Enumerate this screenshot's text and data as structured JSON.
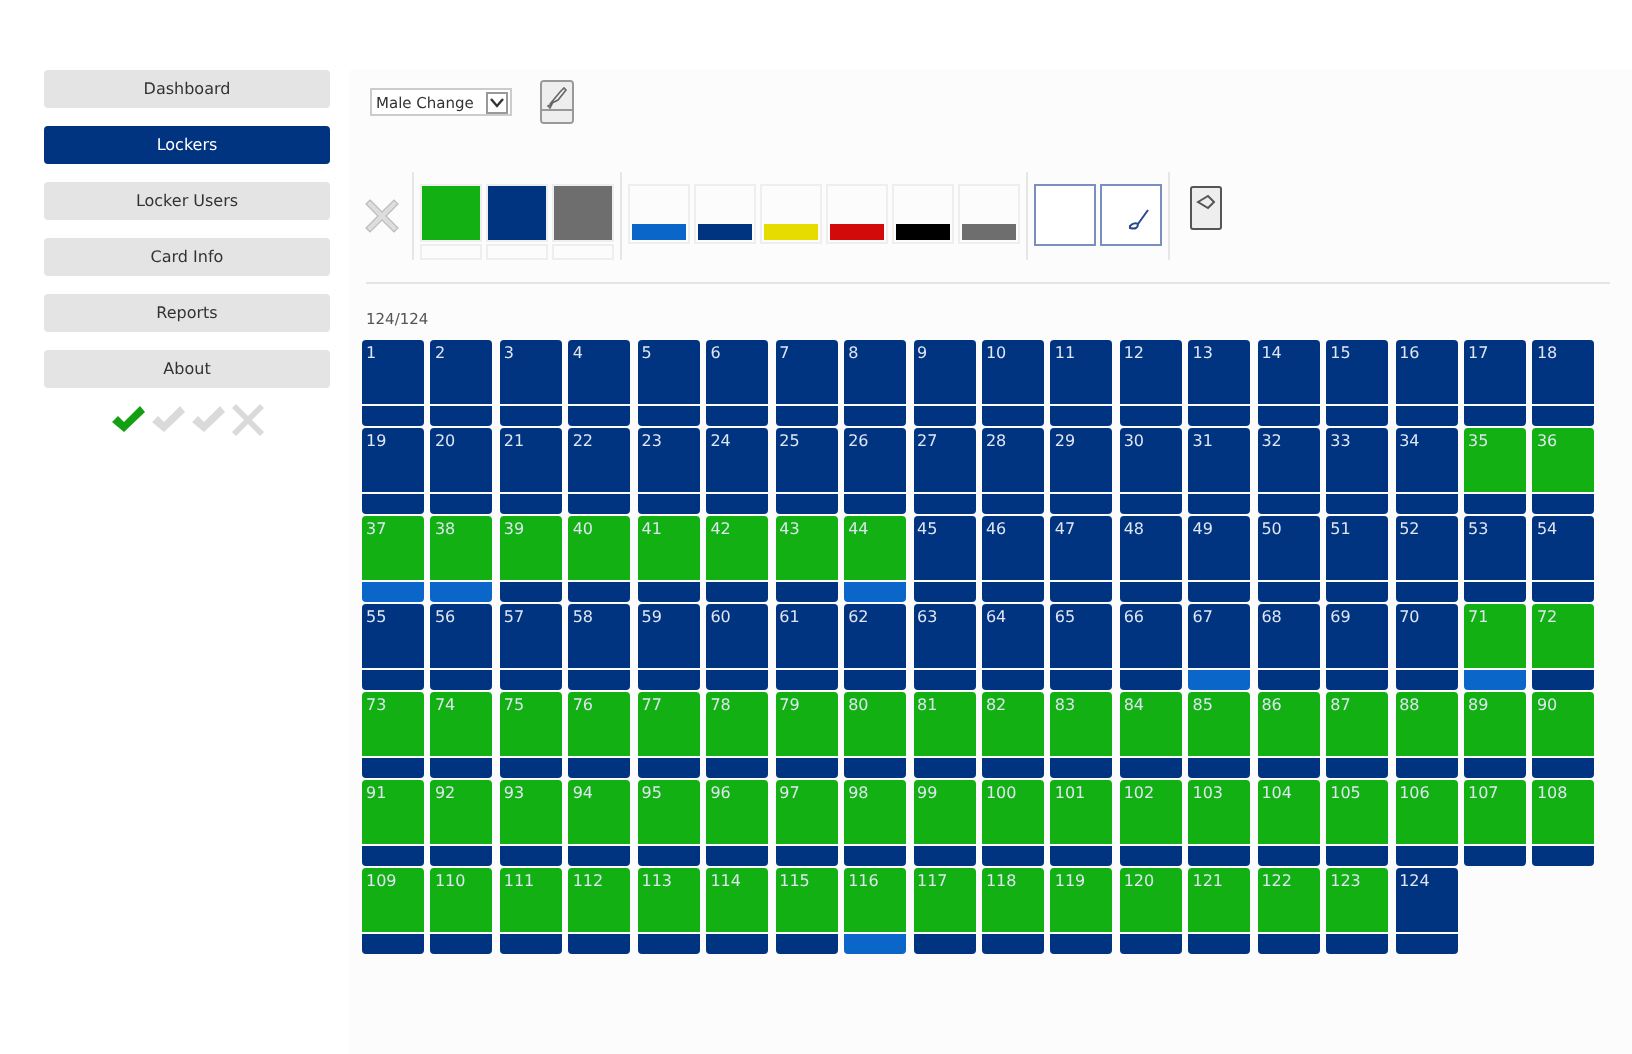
{
  "sidebar": {
    "items": [
      {
        "label": "Dashboard",
        "selected": false
      },
      {
        "label": "Lockers",
        "selected": true
      },
      {
        "label": "Locker Users",
        "selected": false
      },
      {
        "label": "Card Info",
        "selected": false
      },
      {
        "label": "Reports",
        "selected": false
      },
      {
        "label": "About",
        "selected": false
      }
    ],
    "status_icons": [
      {
        "kind": "check",
        "active": true
      },
      {
        "kind": "check",
        "active": false
      },
      {
        "kind": "check",
        "active": false
      },
      {
        "kind": "cross",
        "active": false
      }
    ]
  },
  "area_select": {
    "value": "Male Change"
  },
  "palette": {
    "fill_swatches": [
      {
        "color": "#12b012"
      },
      {
        "color": "#003380"
      },
      {
        "color": "#6e6e6e"
      }
    ],
    "bar_swatches": [
      {
        "color": "#0a66c8"
      },
      {
        "color": "#003380"
      },
      {
        "color": "#e6dc00"
      },
      {
        "color": "#d20a0a"
      },
      {
        "color": "#000000"
      },
      {
        "color": "#6e6e6e"
      }
    ],
    "tools": [
      {
        "kind": "blank"
      },
      {
        "kind": "brush"
      }
    ]
  },
  "count": "124/124",
  "lockers": [
    {
      "number": "1",
      "color": "#003380",
      "bar": {
        "color": "#003380"
      }
    },
    {
      "number": "2",
      "color": "#003380",
      "bar": {
        "color": "#003380"
      }
    },
    {
      "number": "3",
      "color": "#003380",
      "bar": {
        "color": "#003380"
      }
    },
    {
      "number": "4",
      "color": "#003380",
      "bar": {
        "color": "#003380"
      }
    },
    {
      "number": "5",
      "color": "#003380",
      "bar": {
        "color": "#003380"
      }
    },
    {
      "number": "6",
      "color": "#003380",
      "bar": {
        "color": "#003380"
      }
    },
    {
      "number": "7",
      "color": "#003380",
      "bar": {
        "color": "#003380"
      }
    },
    {
      "number": "8",
      "color": "#003380",
      "bar": {
        "color": "#003380"
      }
    },
    {
      "number": "9",
      "color": "#003380",
      "bar": {
        "color": "#003380"
      }
    },
    {
      "number": "10",
      "color": "#003380",
      "bar": {
        "color": "#003380"
      }
    },
    {
      "number": "11",
      "color": "#003380",
      "bar": {
        "color": "#003380"
      }
    },
    {
      "number": "12",
      "color": "#003380",
      "bar": {
        "color": "#003380"
      }
    },
    {
      "number": "13",
      "color": "#003380",
      "bar": {
        "color": "#003380"
      }
    },
    {
      "number": "14",
      "color": "#003380",
      "bar": {
        "color": "#003380"
      }
    },
    {
      "number": "15",
      "color": "#003380",
      "bar": {
        "color": "#003380"
      }
    },
    {
      "number": "16",
      "color": "#003380",
      "bar": {
        "color": "#003380"
      }
    },
    {
      "number": "17",
      "color": "#003380",
      "bar": {
        "color": "#003380"
      }
    },
    {
      "number": "18",
      "color": "#003380",
      "bar": {
        "color": "#003380"
      }
    },
    {
      "number": "19",
      "color": "#003380",
      "bar": {
        "color": "#003380"
      }
    },
    {
      "number": "20",
      "color": "#003380",
      "bar": {
        "color": "#003380"
      }
    },
    {
      "number": "21",
      "color": "#003380",
      "bar": {
        "color": "#003380"
      }
    },
    {
      "number": "22",
      "color": "#003380",
      "bar": {
        "color": "#003380"
      }
    },
    {
      "number": "23",
      "color": "#003380",
      "bar": {
        "color": "#003380"
      }
    },
    {
      "number": "24",
      "color": "#003380",
      "bar": {
        "color": "#003380"
      }
    },
    {
      "number": "25",
      "color": "#003380",
      "bar": {
        "color": "#003380"
      }
    },
    {
      "number": "26",
      "color": "#003380",
      "bar": {
        "color": "#003380"
      }
    },
    {
      "number": "27",
      "color": "#003380",
      "bar": {
        "color": "#003380"
      }
    },
    {
      "number": "28",
      "color": "#003380",
      "bar": {
        "color": "#003380"
      }
    },
    {
      "number": "29",
      "color": "#003380",
      "bar": {
        "color": "#003380"
      }
    },
    {
      "number": "30",
      "color": "#003380",
      "bar": {
        "color": "#003380"
      }
    },
    {
      "number": "31",
      "color": "#003380",
      "bar": {
        "color": "#003380"
      }
    },
    {
      "number": "32",
      "color": "#003380",
      "bar": {
        "color": "#003380"
      }
    },
    {
      "number": "33",
      "color": "#003380",
      "bar": {
        "color": "#003380"
      }
    },
    {
      "number": "34",
      "color": "#003380",
      "bar": {
        "color": "#003380"
      }
    },
    {
      "number": "35",
      "color": "#12b012",
      "bar": {
        "color": "#003380"
      }
    },
    {
      "number": "36",
      "color": "#12b012",
      "bar": {
        "color": "#003380"
      }
    },
    {
      "number": "37",
      "color": "#12b012",
      "bar": {
        "color": "#0a66c8"
      }
    },
    {
      "number": "38",
      "color": "#12b012",
      "bar": {
        "color": "#0a66c8"
      }
    },
    {
      "number": "39",
      "color": "#12b012",
      "bar": {
        "color": "#003380"
      }
    },
    {
      "number": "40",
      "color": "#12b012",
      "bar": {
        "color": "#003380"
      }
    },
    {
      "number": "41",
      "color": "#12b012",
      "bar": {
        "color": "#003380"
      }
    },
    {
      "number": "42",
      "color": "#12b012",
      "bar": {
        "color": "#003380"
      }
    },
    {
      "number": "43",
      "color": "#12b012",
      "bar": {
        "color": "#003380"
      }
    },
    {
      "number": "44",
      "color": "#12b012",
      "bar": {
        "color": "#0a66c8"
      }
    },
    {
      "number": "45",
      "color": "#003380",
      "bar": {
        "color": "#003380"
      }
    },
    {
      "number": "46",
      "color": "#003380",
      "bar": {
        "color": "#003380"
      }
    },
    {
      "number": "47",
      "color": "#003380",
      "bar": {
        "color": "#003380"
      }
    },
    {
      "number": "48",
      "color": "#003380",
      "bar": {
        "color": "#003380"
      }
    },
    {
      "number": "49",
      "color": "#003380",
      "bar": {
        "color": "#003380"
      }
    },
    {
      "number": "50",
      "color": "#003380",
      "bar": {
        "color": "#003380"
      }
    },
    {
      "number": "51",
      "color": "#003380",
      "bar": {
        "color": "#003380"
      }
    },
    {
      "number": "52",
      "color": "#003380",
      "bar": {
        "color": "#003380"
      }
    },
    {
      "number": "53",
      "color": "#003380",
      "bar": {
        "color": "#003380"
      }
    },
    {
      "number": "54",
      "color": "#003380",
      "bar": {
        "color": "#003380"
      }
    },
    {
      "number": "55",
      "color": "#003380",
      "bar": {
        "color": "#003380"
      }
    },
    {
      "number": "56",
      "color": "#003380",
      "bar": {
        "color": "#003380"
      }
    },
    {
      "number": "57",
      "color": "#003380",
      "bar": {
        "color": "#003380"
      }
    },
    {
      "number": "58",
      "color": "#003380",
      "bar": {
        "color": "#003380"
      }
    },
    {
      "number": "59",
      "color": "#003380",
      "bar": {
        "color": "#003380"
      }
    },
    {
      "number": "60",
      "color": "#003380",
      "bar": {
        "color": "#003380"
      }
    },
    {
      "number": "61",
      "color": "#003380",
      "bar": {
        "color": "#003380"
      }
    },
    {
      "number": "62",
      "color": "#003380",
      "bar": {
        "color": "#003380"
      }
    },
    {
      "number": "63",
      "color": "#003380",
      "bar": {
        "color": "#003380"
      }
    },
    {
      "number": "64",
      "color": "#003380",
      "bar": {
        "color": "#003380"
      }
    },
    {
      "number": "65",
      "color": "#003380",
      "bar": {
        "color": "#003380"
      }
    },
    {
      "number": "66",
      "color": "#003380",
      "bar": {
        "color": "#003380"
      }
    },
    {
      "number": "67",
      "color": "#003380",
      "bar": {
        "color": "#0a66c8"
      }
    },
    {
      "number": "68",
      "color": "#003380",
      "bar": {
        "color": "#003380"
      }
    },
    {
      "number": "69",
      "color": "#003380",
      "bar": {
        "color": "#003380"
      }
    },
    {
      "number": "70",
      "color": "#003380",
      "bar": {
        "color": "#003380"
      }
    },
    {
      "number": "71",
      "color": "#12b012",
      "bar": {
        "color": "#0a66c8"
      }
    },
    {
      "number": "72",
      "color": "#12b012",
      "bar": {
        "color": "#003380"
      }
    },
    {
      "number": "73",
      "color": "#12b012",
      "bar": {
        "color": "#003380"
      }
    },
    {
      "number": "74",
      "color": "#12b012",
      "bar": {
        "color": "#003380"
      }
    },
    {
      "number": "75",
      "color": "#12b012",
      "bar": {
        "color": "#003380"
      }
    },
    {
      "number": "76",
      "color": "#12b012",
      "bar": {
        "color": "#003380"
      }
    },
    {
      "number": "77",
      "color": "#12b012",
      "bar": {
        "color": "#003380"
      }
    },
    {
      "number": "78",
      "color": "#12b012",
      "bar": {
        "color": "#003380"
      }
    },
    {
      "number": "79",
      "color": "#12b012",
      "bar": {
        "color": "#003380"
      }
    },
    {
      "number": "80",
      "color": "#12b012",
      "bar": {
        "color": "#003380"
      }
    },
    {
      "number": "81",
      "color": "#12b012",
      "bar": {
        "color": "#003380"
      }
    },
    {
      "number": "82",
      "color": "#12b012",
      "bar": {
        "color": "#003380"
      }
    },
    {
      "number": "83",
      "color": "#12b012",
      "bar": {
        "color": "#003380"
      }
    },
    {
      "number": "84",
      "color": "#12b012",
      "bar": {
        "color": "#003380"
      }
    },
    {
      "number": "85",
      "color": "#12b012",
      "bar": {
        "color": "#003380"
      }
    },
    {
      "number": "86",
      "color": "#12b012",
      "bar": {
        "color": "#003380"
      }
    },
    {
      "number": "87",
      "color": "#12b012",
      "bar": {
        "color": "#003380"
      }
    },
    {
      "number": "88",
      "color": "#12b012",
      "bar": {
        "color": "#003380"
      }
    },
    {
      "number": "89",
      "color": "#12b012",
      "bar": {
        "color": "#003380"
      }
    },
    {
      "number": "90",
      "color": "#12b012",
      "bar": {
        "color": "#003380"
      }
    },
    {
      "number": "91",
      "color": "#12b012",
      "bar": {
        "color": "#003380"
      }
    },
    {
      "number": "92",
      "color": "#12b012",
      "bar": {
        "color": "#003380"
      }
    },
    {
      "number": "93",
      "color": "#12b012",
      "bar": {
        "color": "#003380"
      }
    },
    {
      "number": "94",
      "color": "#12b012",
      "bar": {
        "color": "#003380"
      }
    },
    {
      "number": "95",
      "color": "#12b012",
      "bar": {
        "color": "#003380"
      }
    },
    {
      "number": "96",
      "color": "#12b012",
      "bar": {
        "color": "#003380"
      }
    },
    {
      "number": "97",
      "color": "#12b012",
      "bar": {
        "color": "#003380"
      }
    },
    {
      "number": "98",
      "color": "#12b012",
      "bar": {
        "color": "#003380"
      }
    },
    {
      "number": "99",
      "color": "#12b012",
      "bar": {
        "color": "#003380"
      }
    },
    {
      "number": "100",
      "color": "#12b012",
      "bar": {
        "color": "#003380"
      }
    },
    {
      "number": "101",
      "color": "#12b012",
      "bar": {
        "color": "#003380"
      }
    },
    {
      "number": "102",
      "color": "#12b012",
      "bar": {
        "color": "#003380"
      }
    },
    {
      "number": "103",
      "color": "#12b012",
      "bar": {
        "color": "#003380"
      }
    },
    {
      "number": "104",
      "color": "#12b012",
      "bar": {
        "color": "#003380"
      }
    },
    {
      "number": "105",
      "color": "#12b012",
      "bar": {
        "color": "#003380"
      }
    },
    {
      "number": "106",
      "color": "#12b012",
      "bar": {
        "color": "#003380"
      }
    },
    {
      "number": "107",
      "color": "#12b012",
      "bar": {
        "color": "#003380"
      }
    },
    {
      "number": "108",
      "color": "#12b012",
      "bar": {
        "color": "#003380"
      }
    },
    {
      "number": "109",
      "color": "#12b012",
      "bar": {
        "color": "#003380"
      }
    },
    {
      "number": "110",
      "color": "#12b012",
      "bar": {
        "color": "#003380"
      }
    },
    {
      "number": "111",
      "color": "#12b012",
      "bar": {
        "color": "#003380"
      }
    },
    {
      "number": "112",
      "color": "#12b012",
      "bar": {
        "color": "#003380"
      }
    },
    {
      "number": "113",
      "color": "#12b012",
      "bar": {
        "color": "#003380"
      }
    },
    {
      "number": "114",
      "color": "#12b012",
      "bar": {
        "color": "#003380"
      }
    },
    {
      "number": "115",
      "color": "#12b012",
      "bar": {
        "color": "#003380"
      }
    },
    {
      "number": "116",
      "color": "#12b012",
      "bar": {
        "color": "#0a66c8"
      }
    },
    {
      "number": "117",
      "color": "#12b012",
      "bar": {
        "color": "#003380"
      }
    },
    {
      "number": "118",
      "color": "#12b012",
      "bar": {
        "color": "#003380"
      }
    },
    {
      "number": "119",
      "color": "#12b012",
      "bar": {
        "color": "#003380"
      }
    },
    {
      "number": "120",
      "color": "#12b012",
      "bar": {
        "color": "#003380"
      }
    },
    {
      "number": "121",
      "color": "#12b012",
      "bar": {
        "color": "#003380"
      }
    },
    {
      "number": "122",
      "color": "#12b012",
      "bar": {
        "color": "#003380"
      }
    },
    {
      "number": "123",
      "color": "#12b012",
      "bar": {
        "color": "#003380"
      }
    },
    {
      "number": "124",
      "color": "#003380",
      "bar": {
        "color": "#003380"
      }
    }
  ]
}
